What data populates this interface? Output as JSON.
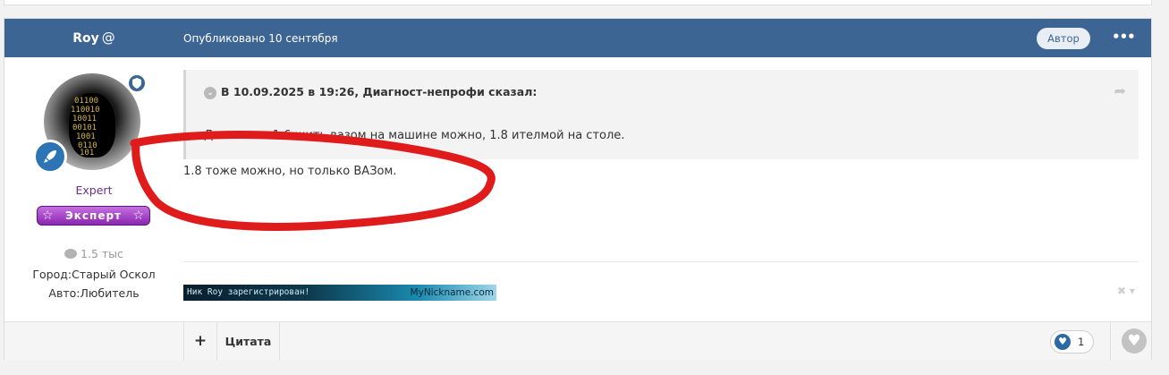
{
  "post": {
    "author": "Roy",
    "author_suffix_icon": "at-icon",
    "date": "Опубликовано 10 сентября",
    "author_badge": "Автор",
    "more_menu_icon": "ellipsis-icon"
  },
  "author_panel": {
    "avatar": "hooded-binary-figure",
    "avatar_digits": [
      "01100",
      "110010",
      "10011",
      "00101",
      "1001",
      "0110",
      "101"
    ],
    "moderator_icon": "shield-icon",
    "rank_icon": "rocket-icon",
    "group_name": "Expert",
    "group_badge": "Эксперт",
    "post_count": "1.5 тыс",
    "city": "Город:Старый Оскол",
    "car": "Авто:Любитель"
  },
  "quote": {
    "header": "В 10.09.2025 в 19:26, Диагност-непрофи сказал:",
    "text": "Двигатель 1.6 шить вазом на машине можно, 1.8 ителмой на столе."
  },
  "reply_text": "1.8 тоже можно, но только ВАЗом.",
  "signature": {
    "left_text": "Ник Roy зарегистрирован!",
    "right_text": "MyNickname.com"
  },
  "footer": {
    "add_label": "+",
    "quote_label": "Цитата",
    "reaction_count": "1"
  },
  "colors": {
    "header_bg": "#3d6594",
    "annotation": "#e01b1b",
    "group_purple": "#6b2f86"
  }
}
